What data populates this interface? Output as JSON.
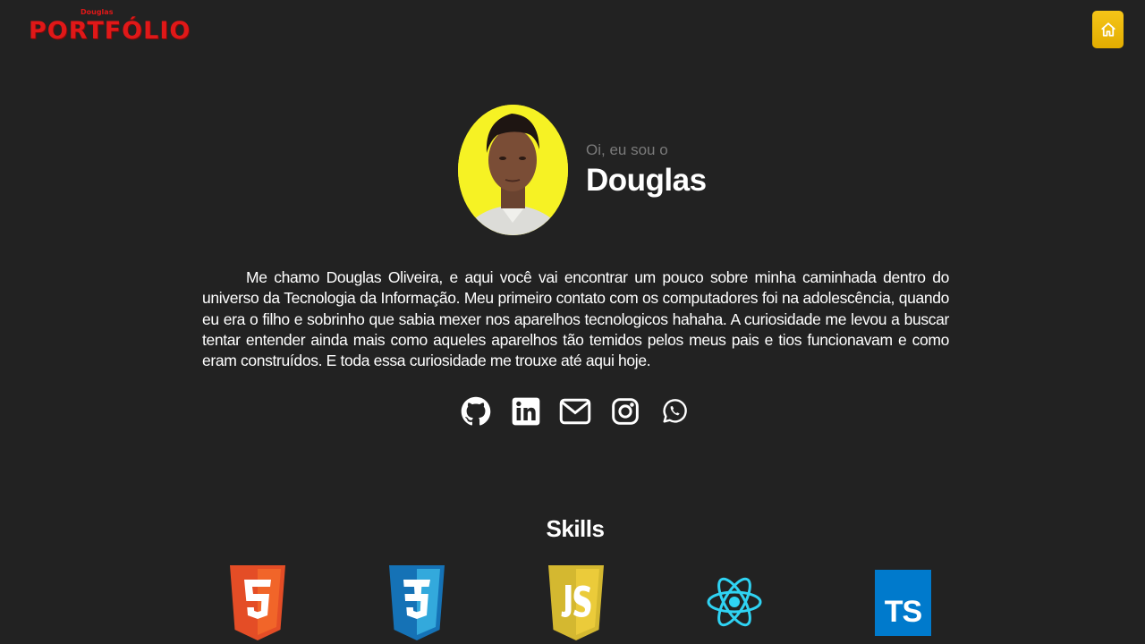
{
  "logo": {
    "small_text": "Douglas",
    "big_text": "PORTFÓLIO",
    "color": "#e01818"
  },
  "nav": {
    "home_icon": "home-icon",
    "accent": "#f5c518"
  },
  "profile": {
    "greeting": "Oi, eu sou o",
    "name": "Douglas",
    "avatar_bg": "#f6f224"
  },
  "bio": {
    "text": "Me chamo Douglas Oliveira, e aqui você vai encontrar um pouco sobre minha caminhada dentro do universo da Tecnologia da Informação. Meu primeiro contato com os computadores foi na adolescência, quando eu era o filho e sobrinho que sabia mexer nos aparelhos tecnologicos hahaha. A curiosidade me levou a buscar tentar entender ainda mais como aqueles aparelhos tão temidos pelos meus pais e tios funcionavam e como eram construídos. E toda essa curiosidade me trouxe até aqui hoje."
  },
  "socials": [
    {
      "icon": "github-icon"
    },
    {
      "icon": "linkedin-icon"
    },
    {
      "icon": "email-icon"
    },
    {
      "icon": "instagram-icon"
    },
    {
      "icon": "whatsapp-icon"
    }
  ],
  "skills": {
    "title": "Skills",
    "items": [
      {
        "icon": "html5-icon",
        "label": "5",
        "color": "#e44d26"
      },
      {
        "icon": "css3-icon",
        "label": "3",
        "color": "#1572b6"
      },
      {
        "icon": "javascript-icon",
        "label": "JS",
        "color": "#d4b830"
      },
      {
        "icon": "react-icon",
        "color": "#2fd3f3"
      },
      {
        "icon": "typescript-icon",
        "label": "TS",
        "color": "#007acc"
      }
    ]
  }
}
